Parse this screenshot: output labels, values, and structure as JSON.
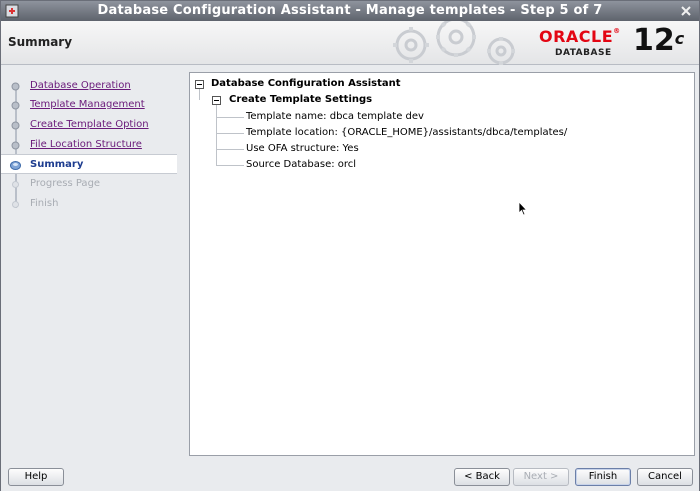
{
  "window": {
    "title": "Database Configuration Assistant - Manage templates - Step 5 of 7"
  },
  "header": {
    "step_title": "Summary",
    "brand": {
      "oracle": "ORACLE",
      "database": "DATABASE",
      "version": "12",
      "version_suffix": "c"
    }
  },
  "nav": {
    "items": [
      {
        "label": "Database Operation",
        "state": "done"
      },
      {
        "label": "Template Management",
        "state": "done"
      },
      {
        "label": "Create Template Option",
        "state": "done"
      },
      {
        "label": "File Location Structure",
        "state": "done"
      },
      {
        "label": "Summary",
        "state": "current"
      },
      {
        "label": "Progress Page",
        "state": "pending"
      },
      {
        "label": "Finish",
        "state": "pending"
      }
    ]
  },
  "summary_tree": {
    "root": "Database Configuration Assistant",
    "section": "Create Template Settings",
    "items": [
      "Template name: dbca template dev",
      "Template location: {ORACLE_HOME}/assistants/dbca/templates/",
      "Use OFA structure: Yes",
      "Source Database: orcl"
    ]
  },
  "footer": {
    "help": "Help",
    "back": "< Back",
    "next": "Next >",
    "finish": "Finish",
    "cancel": "Cancel"
  },
  "colors": {
    "brand_red": "#e30613",
    "link_visited": "#6a1a7a",
    "current_step": "#1d3c8f"
  }
}
